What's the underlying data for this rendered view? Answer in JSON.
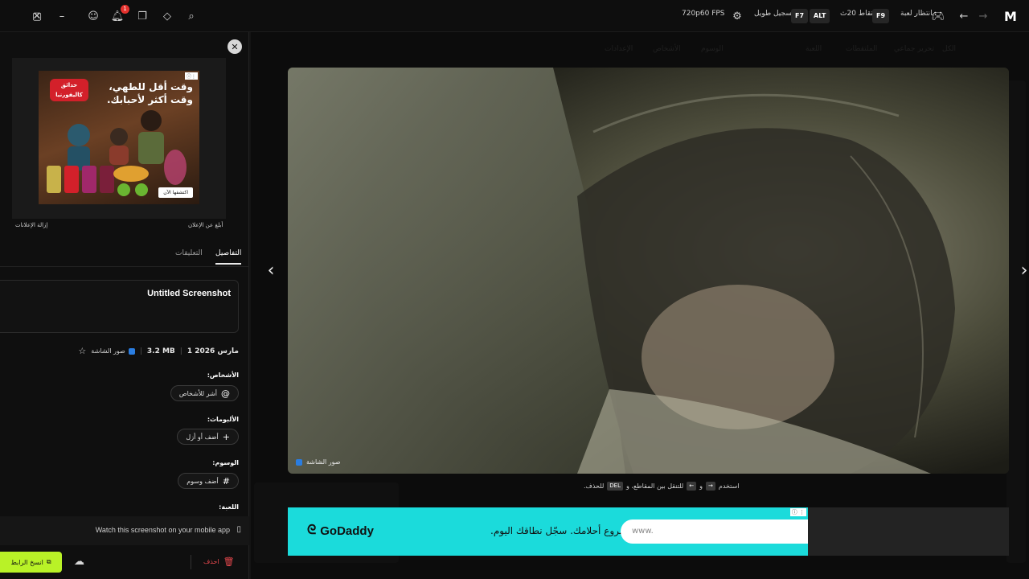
{
  "titlebar": {
    "fps": "720p60 FPS",
    "long_record_label": "تسجيل طويل",
    "key_f7": "F7",
    "key_alt": "ALT",
    "capture_20s_label": "التقاط 20ث",
    "key_f9": "F9",
    "waiting_game_label": "بانتظار لعبة",
    "notification_count": "1"
  },
  "gallery": {
    "faint_items": [
      "الكل",
      "تحرير جماعي",
      "الملتقطات",
      "اللعبة",
      "الوسوم",
      "الأشخاص",
      "الإعدادات"
    ]
  },
  "viewer": {
    "caption": "صور الشاشة",
    "hint_use": "استخدم",
    "hint_and": "و",
    "hint_nav": "للتنقل بين المقاطع، و",
    "hint_del_key": "DEL",
    "hint_delete": "للحذف."
  },
  "bottom_ad": {
    "logo": "GoDaddy",
    "tagline": "ابدأ مشروع أحلامك. سجّل نطاقك اليوم.",
    "input_placeholder": "www."
  },
  "side_ad": {
    "headline": "وقت أقل للطهي، وقت أكثر لأحبابك.",
    "brand": "حدائق كاليفورنيا",
    "cta": "اكتشفها الآن",
    "report_label": "أبلغ عن الإعلان",
    "remove_label": "إزالة الإعلانات"
  },
  "tabs": {
    "details": "التفاصيل",
    "comments": "التعليقات"
  },
  "details": {
    "title": "Untitled Screenshot",
    "date": "1 مارس 2026",
    "size": "3.2 MB",
    "source": "صور الشاشة",
    "people_label": "الأشخاص:",
    "people_pill": "أشر للأشخاص",
    "albums_label": "الألبومات:",
    "albums_pill": "أضف أو أزل",
    "tags_label": "الوسوم:",
    "tags_pill": "أضف وسوم",
    "game_label": "اللعبة:"
  },
  "mobile": {
    "text": "Watch this screenshot on your mobile app"
  },
  "actions": {
    "copy_link": "انسخ الرابط",
    "delete": "احذف"
  },
  "colors": {
    "accent_green": "#b9f227",
    "godaddy_teal": "#1bdbdb",
    "delete_red": "#e5484d"
  }
}
